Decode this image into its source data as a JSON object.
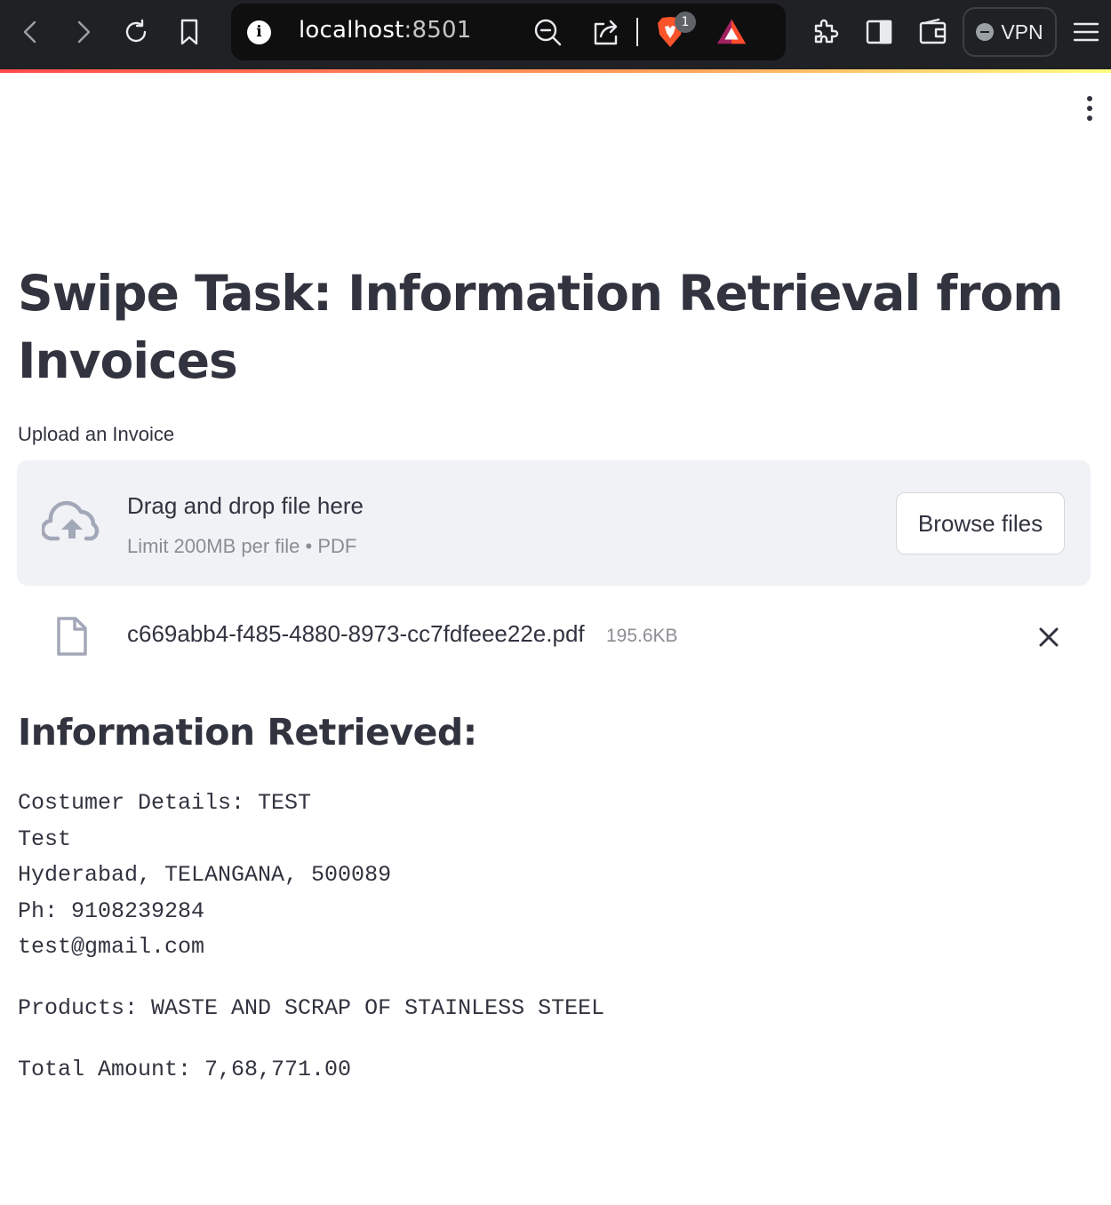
{
  "browser": {
    "url_host": "localhost",
    "url_port": ":8501",
    "shields_count": "1",
    "vpn_label": "VPN"
  },
  "app": {
    "title": "Swipe Task: Information Retrieval from Invoices",
    "uploader": {
      "label": "Upload an Invoice",
      "drop_text": "Drag and drop file here",
      "limit_text": "Limit 200MB per file • PDF",
      "browse_label": "Browse files"
    },
    "uploaded_file": {
      "name": "c669abb4-f485-4880-8973-cc7fdfeee22e.pdf",
      "size": "195.6KB"
    },
    "results": {
      "heading": "Information Retrieved:",
      "customer_lines": [
        "Costumer Details: TEST",
        "Test",
        "Hyderabad, TELANGANA, 500089",
        "Ph: 9108239284",
        "test@gmail.com"
      ],
      "products": "Products: WASTE AND SCRAP OF STAINLESS STEEL",
      "total": "Total Amount: 7,68,771.00"
    }
  }
}
